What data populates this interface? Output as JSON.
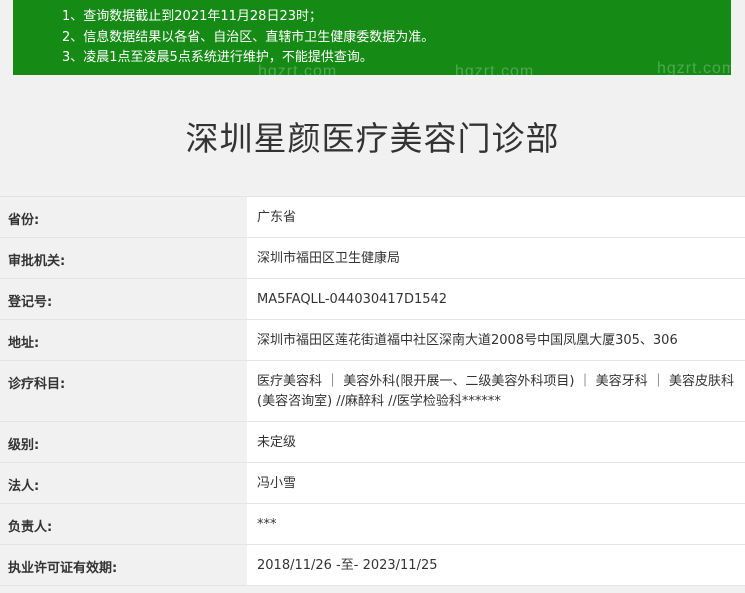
{
  "notice": {
    "lines": [
      "1、查询数据截止到2021年11月28日23时；",
      "2、信息数据结果以各省、自治区、直辖市卫生健康委数据为准。",
      "3、凌晨1点至凌晨5点系统进行维护，不能提供查询。"
    ],
    "watermark": "hgzrt.com"
  },
  "title": "深圳星颜医疗美容门诊部",
  "rows": [
    {
      "label": "省份:",
      "value": "广东省"
    },
    {
      "label": "审批机关:",
      "value": "深圳市福田区卫生健康局"
    },
    {
      "label": "登记号:",
      "value": "MA5FAQLL-044030417D1542"
    },
    {
      "label": "地址:",
      "value": "深圳市福田区莲花街道福中社区深南大道2008号中国凤凰大厦305、306"
    },
    {
      "label": "诊疗科目:",
      "value": "医疗美容科 ｜ 美容外科(限开展一、二级美容外科项目) ｜ 美容牙科 ｜ 美容皮肤科(美容咨询室) //麻醉科 //医学检验科******"
    },
    {
      "label": "级别:",
      "value": "未定级"
    },
    {
      "label": "法人:",
      "value": "冯小雪"
    },
    {
      "label": "负责人:",
      "value": "***"
    },
    {
      "label": "执业许可证有效期:",
      "value": "2018/11/26 -至- 2023/11/25"
    }
  ]
}
